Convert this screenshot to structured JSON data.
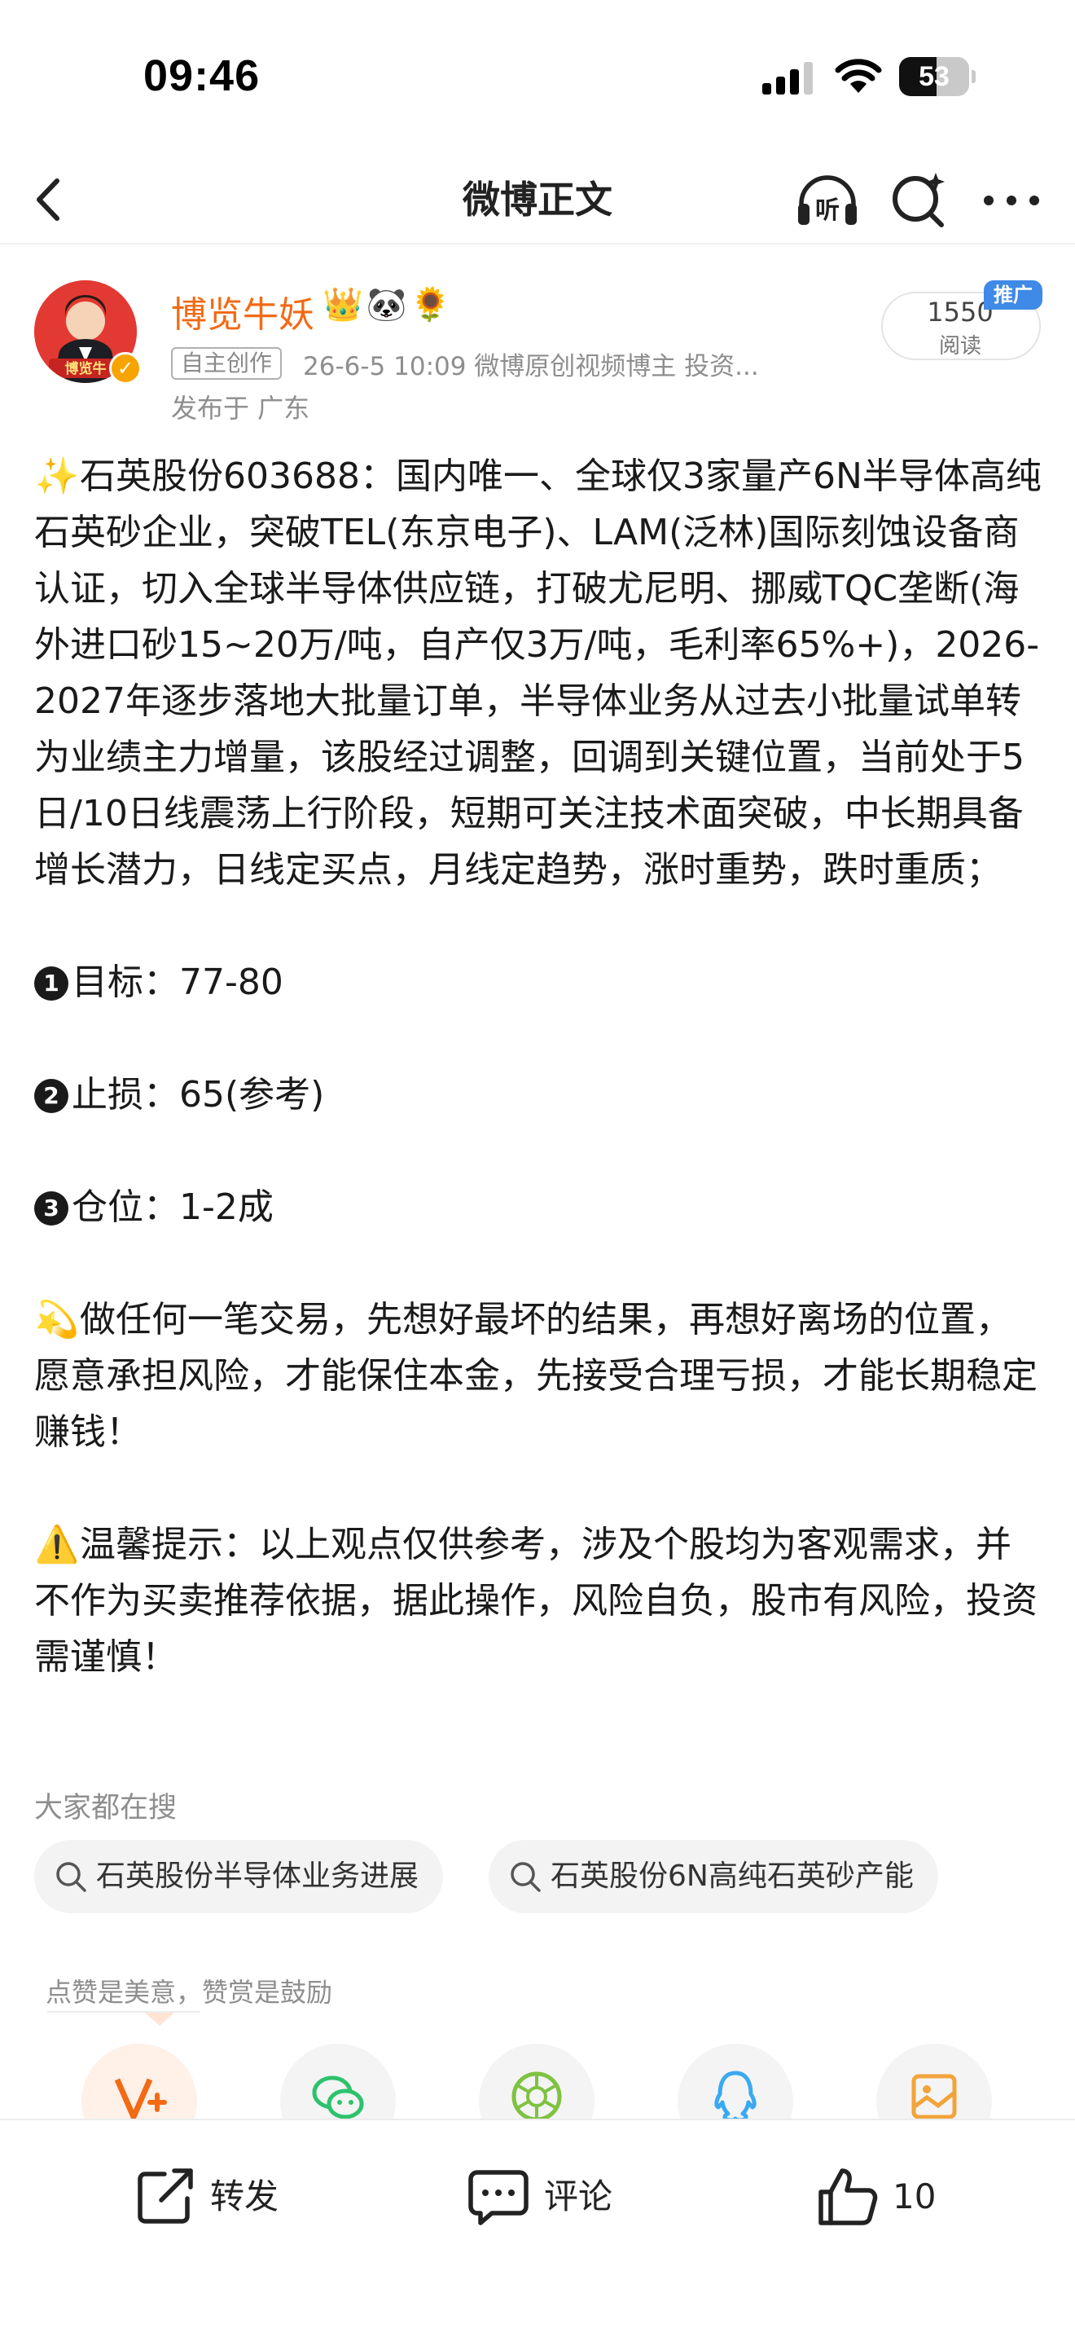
{
  "status_bar": {
    "time": "09:46",
    "battery_level": "53",
    "battery_percent": 53
  },
  "nav": {
    "title": "微博正文"
  },
  "author": {
    "name": "博览牛妖",
    "emojis": "👑🐼🌻",
    "avatar_text": "博览牛",
    "verified_mark": "✓",
    "tag": "自主创作",
    "meta": "26-6-5 10:09  微博原创视频博主 投资...",
    "location": "发布于 广东",
    "read_count": "1550",
    "read_label": "阅读",
    "ad_badge": "推广"
  },
  "post": {
    "para1_emoji": "✨",
    "para1": "石英股份603688：国内唯一、全球仅3家量产6N半导体高纯石英砂企业，突破TEL(东京电子)、LAM(泛林)国际刻蚀设备商认证，切入全球半导体供应链，打破尤尼明、挪威TQC垄断(海外进口砂15~20万/吨，自产仅3万/吨，毛利率65%+)，2026-2027年逐步落地大批量订单，半导体业务从过去小批量试单转为业绩主力增量，该股经过调整，回调到关键位置，当前处于5日/10日线震荡上行阶段，短期可关注技术面突破，中长期具备增长潜力，日线定买点，月线定趋势，涨时重势，跌时重质；",
    "item1_num": "1",
    "item1": "目标：77-80",
    "item2_num": "2",
    "item2": "止损：65(参考)",
    "item3_num": "3",
    "item3": "仓位：1-2成",
    "para2_emoji": "💫",
    "para2": "做任何一笔交易，先想好最坏的结果，再想好离场的位置，愿意承担风险，才能保住本金，先接受合理亏损，才能长期稳定赚钱！",
    "para3_emoji": "⚠️",
    "para3": "温馨提示：以上观点仅供参考，涉及个股均为客观需求，并不作为买卖推荐依据，据此操作，风险自负，股市有风险，投资需谨慎！"
  },
  "hot_search": {
    "title": "大家都在搜",
    "items": [
      "石英股份半导体业务进展",
      "石英股份6N高纯石英砂产能"
    ]
  },
  "reward": {
    "text": "点赞是美意，赞赏是鼓励"
  },
  "share_icons": [
    "reward-v-icon",
    "wechat-icon",
    "moments-icon",
    "qq-icon",
    "save-image-icon"
  ],
  "actions": {
    "repost": "转发",
    "comment": "评论",
    "like_count": "10"
  },
  "colors": {
    "author_name": "#f26a14",
    "ad_badge": "#3f8ae6",
    "wechat": "#2dc26b",
    "moments": "#7fc241",
    "qq": "#3aa9f2",
    "save": "#f2a43a",
    "reward": "#f26a14"
  }
}
